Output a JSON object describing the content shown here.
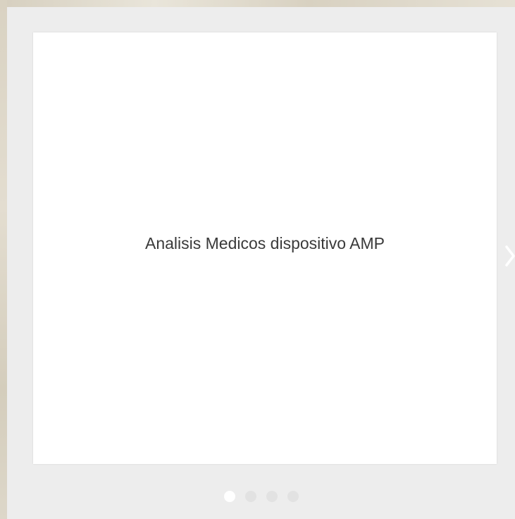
{
  "slide": {
    "text": "Analisis Medicos dispositivo AMP"
  },
  "navigation": {
    "next_icon": "chevron-right-icon"
  },
  "pagination": {
    "total": 4,
    "active_index": 0
  },
  "colors": {
    "carousel_bg": "#ededed",
    "slide_bg": "#ffffff",
    "text": "#3a3a3a",
    "dot_inactive": "#e2e2e2",
    "dot_active": "#ffffff"
  }
}
